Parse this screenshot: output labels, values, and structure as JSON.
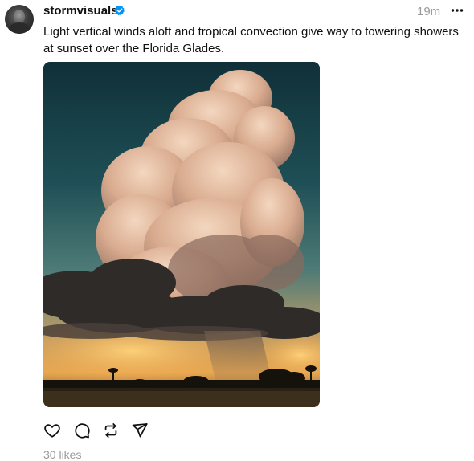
{
  "post": {
    "username": "stormvisuals",
    "timestamp": "19m",
    "caption": "Light vertical winds aloft and tropical convection give way to towering showers at sunset over the Florida Glades.",
    "likes": "30 likes"
  },
  "icons": {
    "verified": "verified-badge-icon",
    "more": "more-options-icon",
    "like": "heart-icon",
    "comment": "comment-icon",
    "repost": "repost-icon",
    "share": "send-icon"
  },
  "colors": {
    "verified_badge": "#0095f6",
    "secondary_text": "#999999",
    "primary_text": "#101010"
  }
}
